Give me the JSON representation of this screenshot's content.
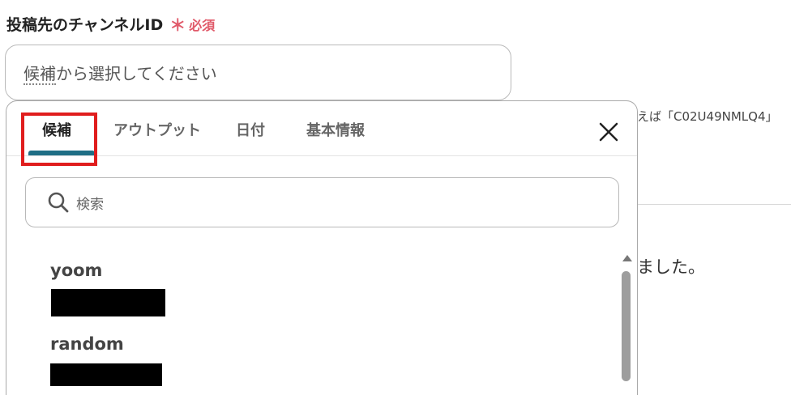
{
  "field": {
    "label": "投稿先のチャンネルID",
    "required_star": "＊",
    "required_text": "必須",
    "select_placeholder_a": "候補",
    "select_placeholder_b": "から選択してください"
  },
  "background": {
    "hint_text": "えば「C02U49NMLQ4」",
    "message_text": "ました。"
  },
  "popup": {
    "tabs": [
      {
        "label": "候補",
        "active": true
      },
      {
        "label": "アウトプット",
        "active": false
      },
      {
        "label": "日付",
        "active": false
      },
      {
        "label": "基本情報",
        "active": false
      }
    ],
    "close_icon": "close-icon",
    "search": {
      "icon": "search-icon",
      "placeholder": "検索"
    },
    "items": [
      {
        "name": "yoom",
        "id_redacted": true
      },
      {
        "name": "random",
        "id_redacted": true
      }
    ]
  },
  "colors": {
    "required": "#e05a6a",
    "active_tab_underline": "#1f6e85",
    "highlight_box": "#e01d1d"
  }
}
